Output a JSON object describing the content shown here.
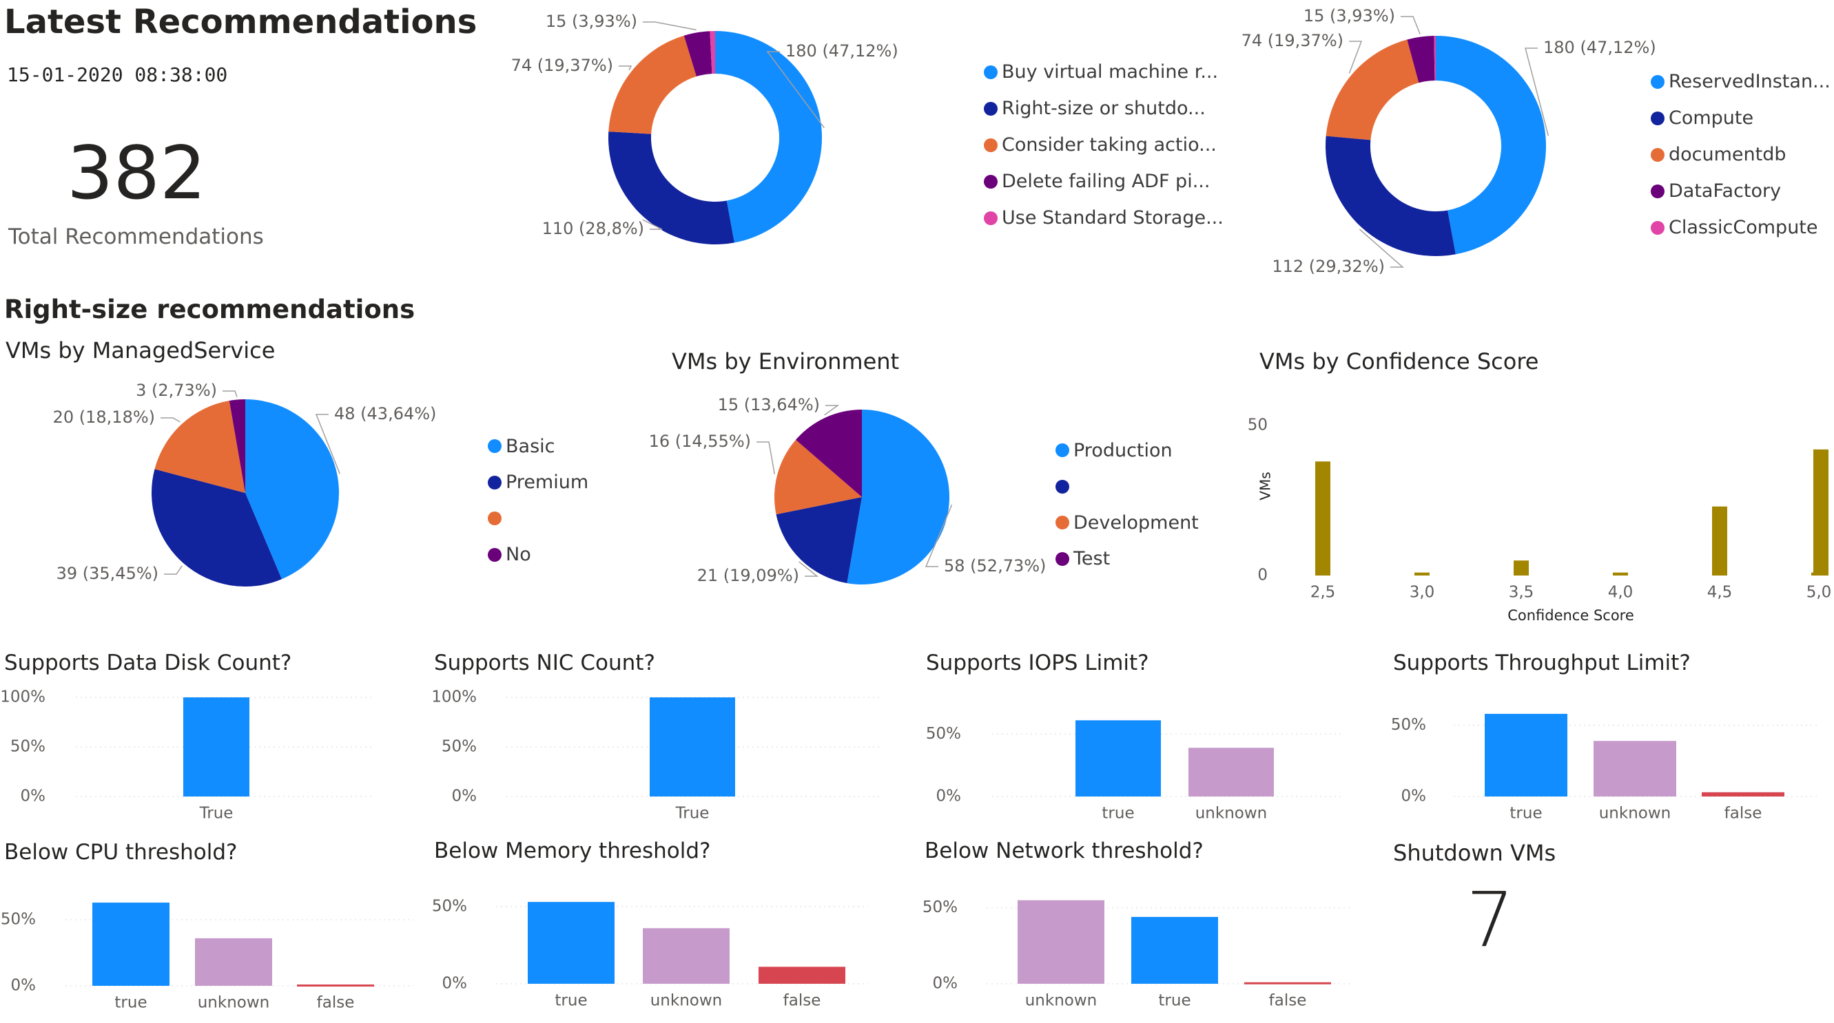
{
  "header": {
    "title": "Latest Recommendations",
    "timestamp": "15-01-2020 08:38:00",
    "kpi_value": "382",
    "kpi_label": "Total Recommendations"
  },
  "section_title": "Right-size recommendations",
  "colors": {
    "blue": "#118DFF",
    "navy": "#12239E",
    "orange": "#E66C37",
    "purple": "#6B007B",
    "pink": "#E044A7",
    "lilac": "#C69BCB",
    "red": "#D64550",
    "olive": "#A38600"
  },
  "shutdown": {
    "title": "Shutdown VMs",
    "value": "7"
  },
  "chart_data": [
    {
      "id": "recs-by-type",
      "type": "pie",
      "donut": true,
      "title": "",
      "slices": [
        {
          "name": "Buy virtual machine r...",
          "value": 180,
          "label": "180 (47,12%)",
          "color": "#118DFF"
        },
        {
          "name": "Right-size or shutdo...",
          "value": 110,
          "label": "110 (28,8%)",
          "color": "#12239E"
        },
        {
          "name": "Consider taking actio...",
          "value": 74,
          "label": "74 (19,37%)",
          "color": "#E66C37"
        },
        {
          "name": "Delete failing ADF pi...",
          "value": 15,
          "label": "15 (3,93%)",
          "color": "#6B007B"
        },
        {
          "name": "Use Standard Storage...",
          "value": 3,
          "label": "",
          "color": "#E044A7"
        }
      ],
      "legend": [
        "Buy virtual machine r...",
        "Right-size or shutdo...",
        "Consider taking actio...",
        "Delete failing ADF pi...",
        "Use Standard Storage..."
      ],
      "legend_position": "right"
    },
    {
      "id": "recs-by-category",
      "type": "pie",
      "donut": true,
      "title": "",
      "slices": [
        {
          "name": "ReservedInstan...",
          "value": 180,
          "label": "180 (47,12%)",
          "color": "#118DFF"
        },
        {
          "name": "Compute",
          "value": 112,
          "label": "112 (29,32%)",
          "color": "#12239E"
        },
        {
          "name": "documentdb",
          "value": 74,
          "label": "74 (19,37%)",
          "color": "#E66C37"
        },
        {
          "name": "DataFactory",
          "value": 15,
          "label": "15 (3,93%)",
          "color": "#6B007B"
        },
        {
          "name": "ClassicCompute",
          "value": 1,
          "label": "",
          "color": "#E044A7"
        }
      ],
      "legend": [
        "ReservedInstan...",
        "Compute",
        "documentdb",
        "DataFactory",
        "ClassicCompute"
      ],
      "legend_position": "right"
    },
    {
      "id": "vms-by-managed-service",
      "type": "pie",
      "donut": false,
      "title": "VMs by ManagedService",
      "slices": [
        {
          "name": "Basic",
          "value": 48,
          "label": "48 (43,64%)",
          "color": "#118DFF"
        },
        {
          "name": "Premium",
          "value": 39,
          "label": "39 (35,45%)",
          "color": "#12239E"
        },
        {
          "name": "",
          "value": 20,
          "label": "20 (18,18%)",
          "color": "#E66C37"
        },
        {
          "name": "No",
          "value": 3,
          "label": "3 (2,73%)",
          "color": "#6B007B"
        }
      ],
      "legend": [
        "Basic",
        "Premium",
        "",
        "No"
      ],
      "legend_position": "right"
    },
    {
      "id": "vms-by-environment",
      "type": "pie",
      "donut": false,
      "title": "VMs by Environment",
      "slices": [
        {
          "name": "Production",
          "value": 58,
          "label": "58 (52,73%)",
          "color": "#118DFF"
        },
        {
          "name": "",
          "value": 21,
          "label": "21 (19,09%)",
          "color": "#12239E"
        },
        {
          "name": "Development",
          "value": 16,
          "label": "16 (14,55%)",
          "color": "#E66C37"
        },
        {
          "name": "Test",
          "value": 15,
          "label": "15 (13,64%)",
          "color": "#6B007B"
        }
      ],
      "legend": [
        "Production",
        "",
        "Development",
        "Test"
      ],
      "legend_position": "right"
    },
    {
      "id": "vms-by-confidence",
      "type": "bar",
      "title": "VMs by Confidence Score",
      "xlabel": "Confidence Score",
      "ylabel": "VMs",
      "x": [
        2.5,
        3.0,
        3.5,
        4.0,
        4.5,
        5.0
      ],
      "values": [
        38,
        1,
        5,
        1,
        23,
        1
      ],
      "extra_bar": {
        "x": 5.0,
        "value": 42
      },
      "x_tick_labels": [
        "2,5",
        "3,0",
        "3,5",
        "4,0",
        "4,5",
        "5,0"
      ],
      "y_ticks": [
        "0",
        "50"
      ],
      "ylim": [
        0,
        50
      ],
      "color": "#A38600"
    },
    {
      "id": "supports-data-disk",
      "type": "bar",
      "title": "Supports Data Disk Count?",
      "categories": [
        "True"
      ],
      "values": [
        100
      ],
      "colors": [
        "#118DFF"
      ],
      "y_ticks": [
        "100%",
        "50%",
        "0%"
      ],
      "ylim": [
        0,
        100
      ]
    },
    {
      "id": "supports-nic",
      "type": "bar",
      "title": "Supports NIC Count?",
      "categories": [
        "True"
      ],
      "values": [
        100
      ],
      "colors": [
        "#118DFF"
      ],
      "y_ticks": [
        "100%",
        "50%",
        "0%"
      ],
      "ylim": [
        0,
        100
      ]
    },
    {
      "id": "supports-iops",
      "type": "bar",
      "title": "Supports IOPS Limit?",
      "categories": [
        "true",
        "unknown"
      ],
      "values": [
        61,
        39
      ],
      "colors": [
        "#118DFF",
        "#C69BCB"
      ],
      "y_ticks": [
        "50%",
        "0%"
      ],
      "ylim": [
        0,
        81
      ]
    },
    {
      "id": "supports-throughput",
      "type": "bar",
      "title": "Supports Throughput Limit?",
      "categories": [
        "true",
        "unknown",
        "false"
      ],
      "values": [
        58,
        39,
        3
      ],
      "colors": [
        "#118DFF",
        "#C69BCB",
        "#D64550"
      ],
      "y_ticks": [
        "50%",
        "0%"
      ],
      "ylim": [
        0,
        71
      ]
    },
    {
      "id": "below-cpu",
      "type": "bar",
      "title": "Below CPU threshold?",
      "categories": [
        "true",
        "unknown",
        "false"
      ],
      "values": [
        63,
        36,
        1
      ],
      "colors": [
        "#118DFF",
        "#C69BCB",
        "#D64550"
      ],
      "y_ticks": [
        "50%",
        "0%"
      ],
      "ylim": [
        0,
        74
      ]
    },
    {
      "id": "below-memory",
      "type": "bar",
      "title": "Below Memory threshold?",
      "categories": [
        "true",
        "unknown",
        "false"
      ],
      "values": [
        53,
        36,
        11
      ],
      "colors": [
        "#118DFF",
        "#C69BCB",
        "#D64550"
      ],
      "y_ticks": [
        "50%",
        "0%"
      ],
      "ylim": [
        0,
        62
      ]
    },
    {
      "id": "below-network",
      "type": "bar",
      "title": "Below Network threshold?",
      "categories": [
        "unknown",
        "true",
        "false"
      ],
      "values": [
        55,
        44,
        1
      ],
      "colors": [
        "#C69BCB",
        "#118DFF",
        "#D64550"
      ],
      "y_ticks": [
        "50%",
        "0%"
      ],
      "ylim": [
        0,
        63
      ]
    }
  ]
}
